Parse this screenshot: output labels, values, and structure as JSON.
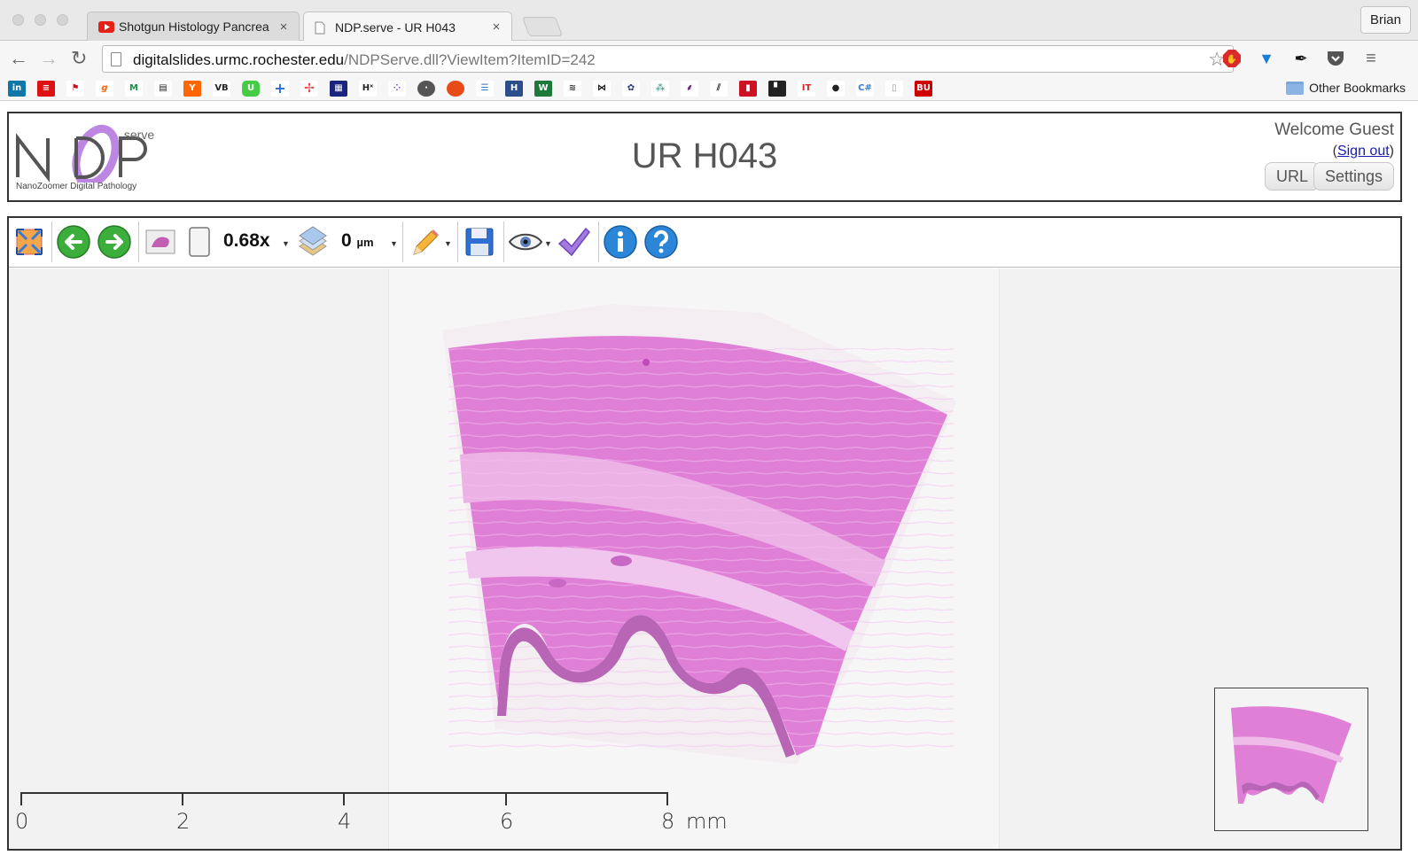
{
  "browser": {
    "tabs": [
      {
        "title": "Shotgun Histology Pancrea",
        "favicon": "youtube-icon",
        "active": false
      },
      {
        "title": "NDP.serve - UR H043",
        "favicon": "page-icon",
        "active": true
      }
    ],
    "profile_name": "Brian",
    "url": {
      "host": "digitalslides.urmc.rochester.edu",
      "path": "/NDPServe.dll?ViewItem?ItemID=242"
    },
    "bookmarks_other": "Other Bookmarks"
  },
  "header": {
    "logo_serve": ".serve",
    "logo_subtitle": "NanoZoomer Digital Pathology",
    "title": "UR H043",
    "welcome": "Welcome Guest",
    "signout_prefix": "(",
    "signout_link": "Sign out",
    "signout_suffix": ")",
    "url_button": "URL",
    "settings_button": "Settings"
  },
  "viewer": {
    "zoom": "0.68x",
    "focus_value": "0",
    "focus_unit": "µm",
    "scale_labels": [
      "0",
      "2",
      "4",
      "6",
      "8"
    ],
    "scale_unit": "mm"
  }
}
